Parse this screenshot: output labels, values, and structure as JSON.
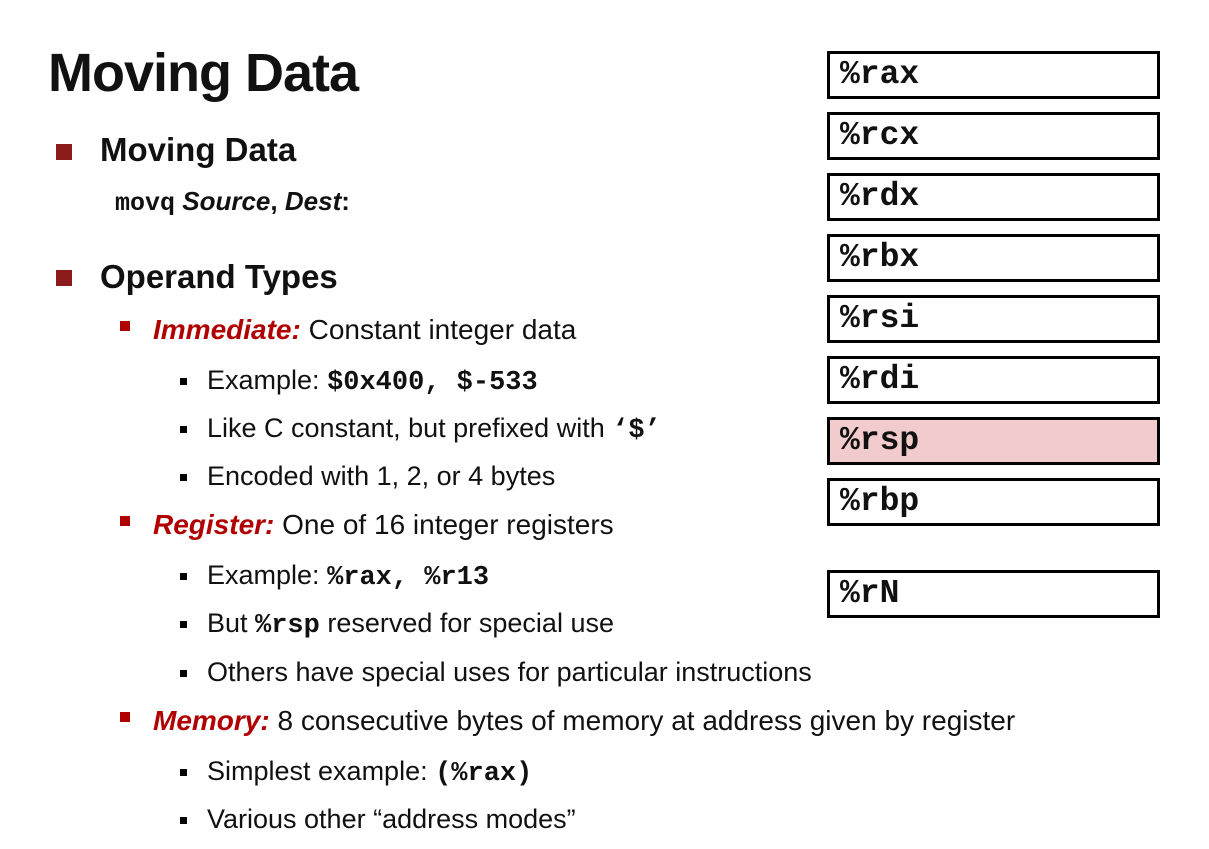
{
  "colors": {
    "accent_red": "#b00000",
    "bullet_dark_red": "#8b1a1a",
    "highlight_pink": "#f2cccc",
    "text": "#111111"
  },
  "slide": {
    "title": "Moving Data",
    "section_moving": {
      "heading": "Moving Data",
      "syntax_code": "movq",
      "syntax_source": "Source",
      "syntax_comma": ",",
      "syntax_dest": "Dest",
      "syntax_colon": ":"
    },
    "section_operands": {
      "heading": "Operand Types",
      "immediate": {
        "label": "Immediate:",
        "desc": "Constant integer data",
        "ex_prefix": "Example: ",
        "ex_code": "$0x400, $-533",
        "like_prefix": "Like C constant, but prefixed with ",
        "like_code": "‘$’",
        "encoded": "Encoded with 1, 2, or 4 bytes"
      },
      "register": {
        "label": "Register:",
        "desc": "One of 16 integer registers",
        "ex_prefix": "Example: ",
        "ex_code": "%rax, %r13",
        "but_prefix": "But ",
        "but_code": "%rsp",
        "but_suffix": " reserved for special use",
        "others": "Others have special uses for particular instructions"
      },
      "memory": {
        "label": "Memory:",
        "desc": "8 consecutive bytes of memory at address given by register",
        "ex_prefix": "Simplest example: ",
        "ex_code": "(%rax)",
        "various": "Various other “address modes”"
      }
    }
  },
  "registers": [
    "%rax",
    "%rcx",
    "%rdx",
    "%rbx",
    "%rsi",
    "%rdi",
    "%rsp",
    "%rbp"
  ],
  "register_n": "%rN",
  "highlighted_register": "%rsp"
}
